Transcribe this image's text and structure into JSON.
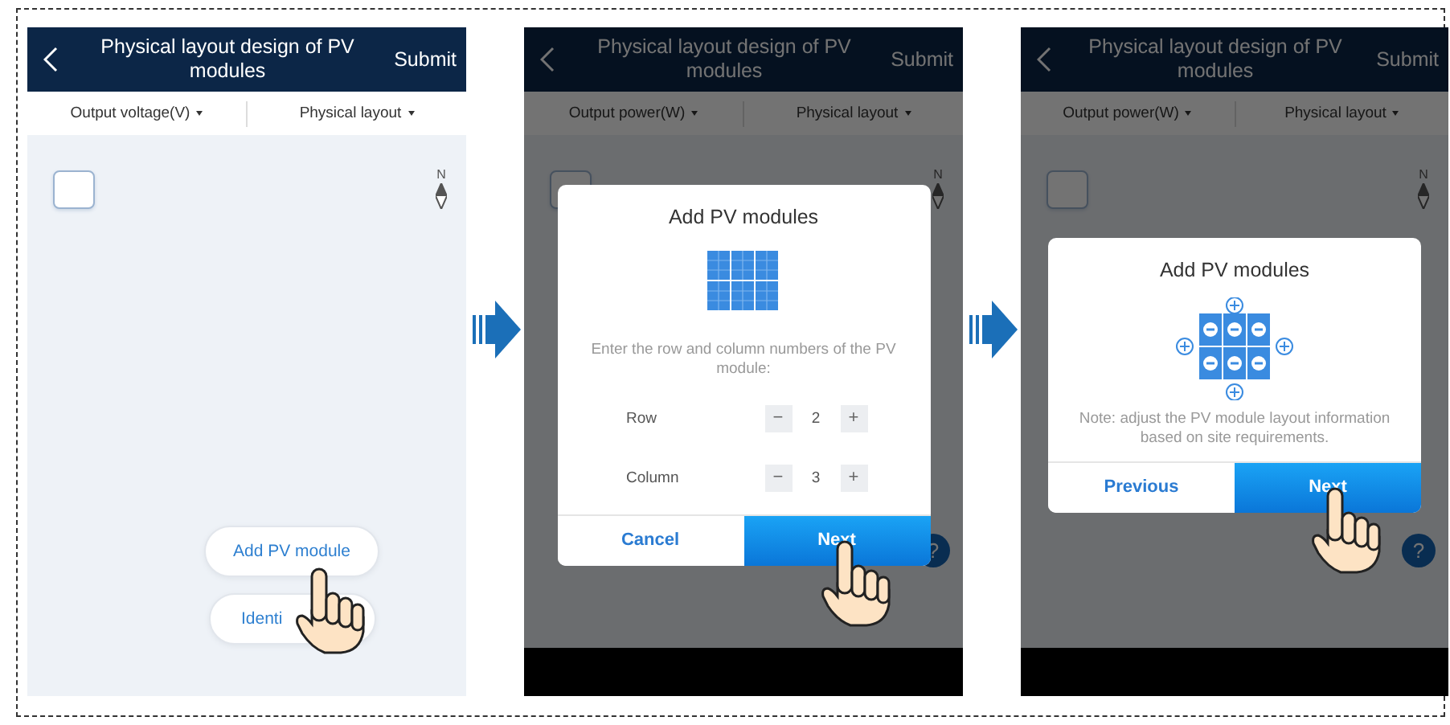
{
  "screens": [
    {
      "header": {
        "title": "Physical layout design of PV modules",
        "action": "Submit"
      },
      "filters": [
        "Output voltage(V)",
        "Physical layout"
      ],
      "compass_label": "N",
      "dimmed": false,
      "actions": [
        {
          "label": "Add PV module",
          "tapped": true
        },
        {
          "label": "Identi",
          "tapped": false
        }
      ]
    },
    {
      "header": {
        "title": "Physical layout design of PV modules",
        "action": "Submit"
      },
      "filters": [
        "Output power(W)",
        "Physical layout"
      ],
      "compass_label": "N",
      "dimmed": true,
      "help": "?",
      "dialog": {
        "kind": "size-entry",
        "title": "Add PV modules",
        "prompt": "Enter the row and column numbers of the PV module:",
        "fields": [
          {
            "label": "Row",
            "decrement": "−",
            "value": "2",
            "increment": "+"
          },
          {
            "label": "Column",
            "decrement": "−",
            "value": "3",
            "increment": "+"
          }
        ],
        "buttons": [
          {
            "label": "Cancel",
            "primary": false,
            "tapped": false
          },
          {
            "label": "Next",
            "primary": true,
            "tapped": true
          }
        ]
      }
    },
    {
      "header": {
        "title": "Physical layout design of PV modules",
        "action": "Submit"
      },
      "filters": [
        "Output power(W)",
        "Physical layout"
      ],
      "compass_label": "N",
      "dimmed": true,
      "help": "?",
      "dialog": {
        "kind": "layout-preview",
        "title": "Add PV modules",
        "note": "Note: adjust the PV module layout information based on site requirements.",
        "buttons": [
          {
            "label": "Previous",
            "primary": false,
            "tapped": false
          },
          {
            "label": "Next",
            "primary": true,
            "tapped": true
          }
        ]
      }
    }
  ]
}
